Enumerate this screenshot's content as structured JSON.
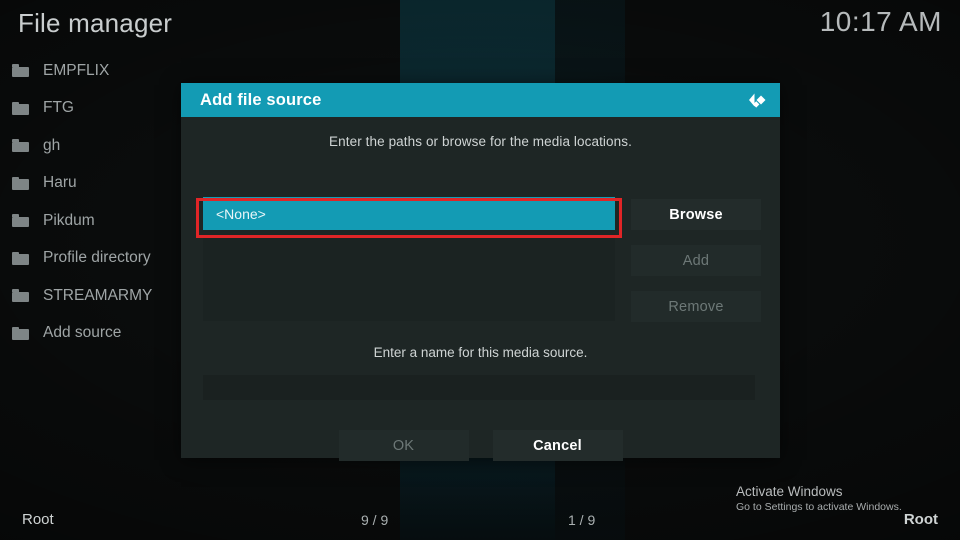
{
  "app": {
    "title": "File manager",
    "clock": "10:17 AM"
  },
  "sidebar": {
    "items": [
      {
        "label": "EMPFLIX",
        "icon": "folder-icon"
      },
      {
        "label": "FTG",
        "icon": "folder-icon"
      },
      {
        "label": "gh",
        "icon": "folder-icon"
      },
      {
        "label": "Haru",
        "icon": "folder-icon"
      },
      {
        "label": "Pikdum",
        "icon": "folder-icon"
      },
      {
        "label": "Profile directory",
        "icon": "folder-icon"
      },
      {
        "label": "STREAMARMY",
        "icon": "folder-icon"
      },
      {
        "label": "Add source",
        "icon": "folder-icon"
      }
    ]
  },
  "dialog": {
    "title": "Add file source",
    "logo_icon": "kodi-logo-icon",
    "hint": "Enter the paths or browse for the media locations.",
    "path_value": "<None>",
    "buttons": {
      "browse": "Browse",
      "add": "Add",
      "remove": "Remove"
    },
    "name_hint": "Enter a name for this media source.",
    "name_value": "",
    "ok": "OK",
    "cancel": "Cancel"
  },
  "statusbar": {
    "left": "Root",
    "middle_left": "9 / 9",
    "middle_right": "1 / 9",
    "right": "Root"
  },
  "watermark": {
    "title": "Activate Windows",
    "subtitle": "Go to Settings to activate Windows."
  },
  "colors": {
    "accent": "#139bb4",
    "dialog_bg": "#1e2625",
    "highlight_box": "#e02527",
    "screen_bg": "#0a0c0c"
  }
}
